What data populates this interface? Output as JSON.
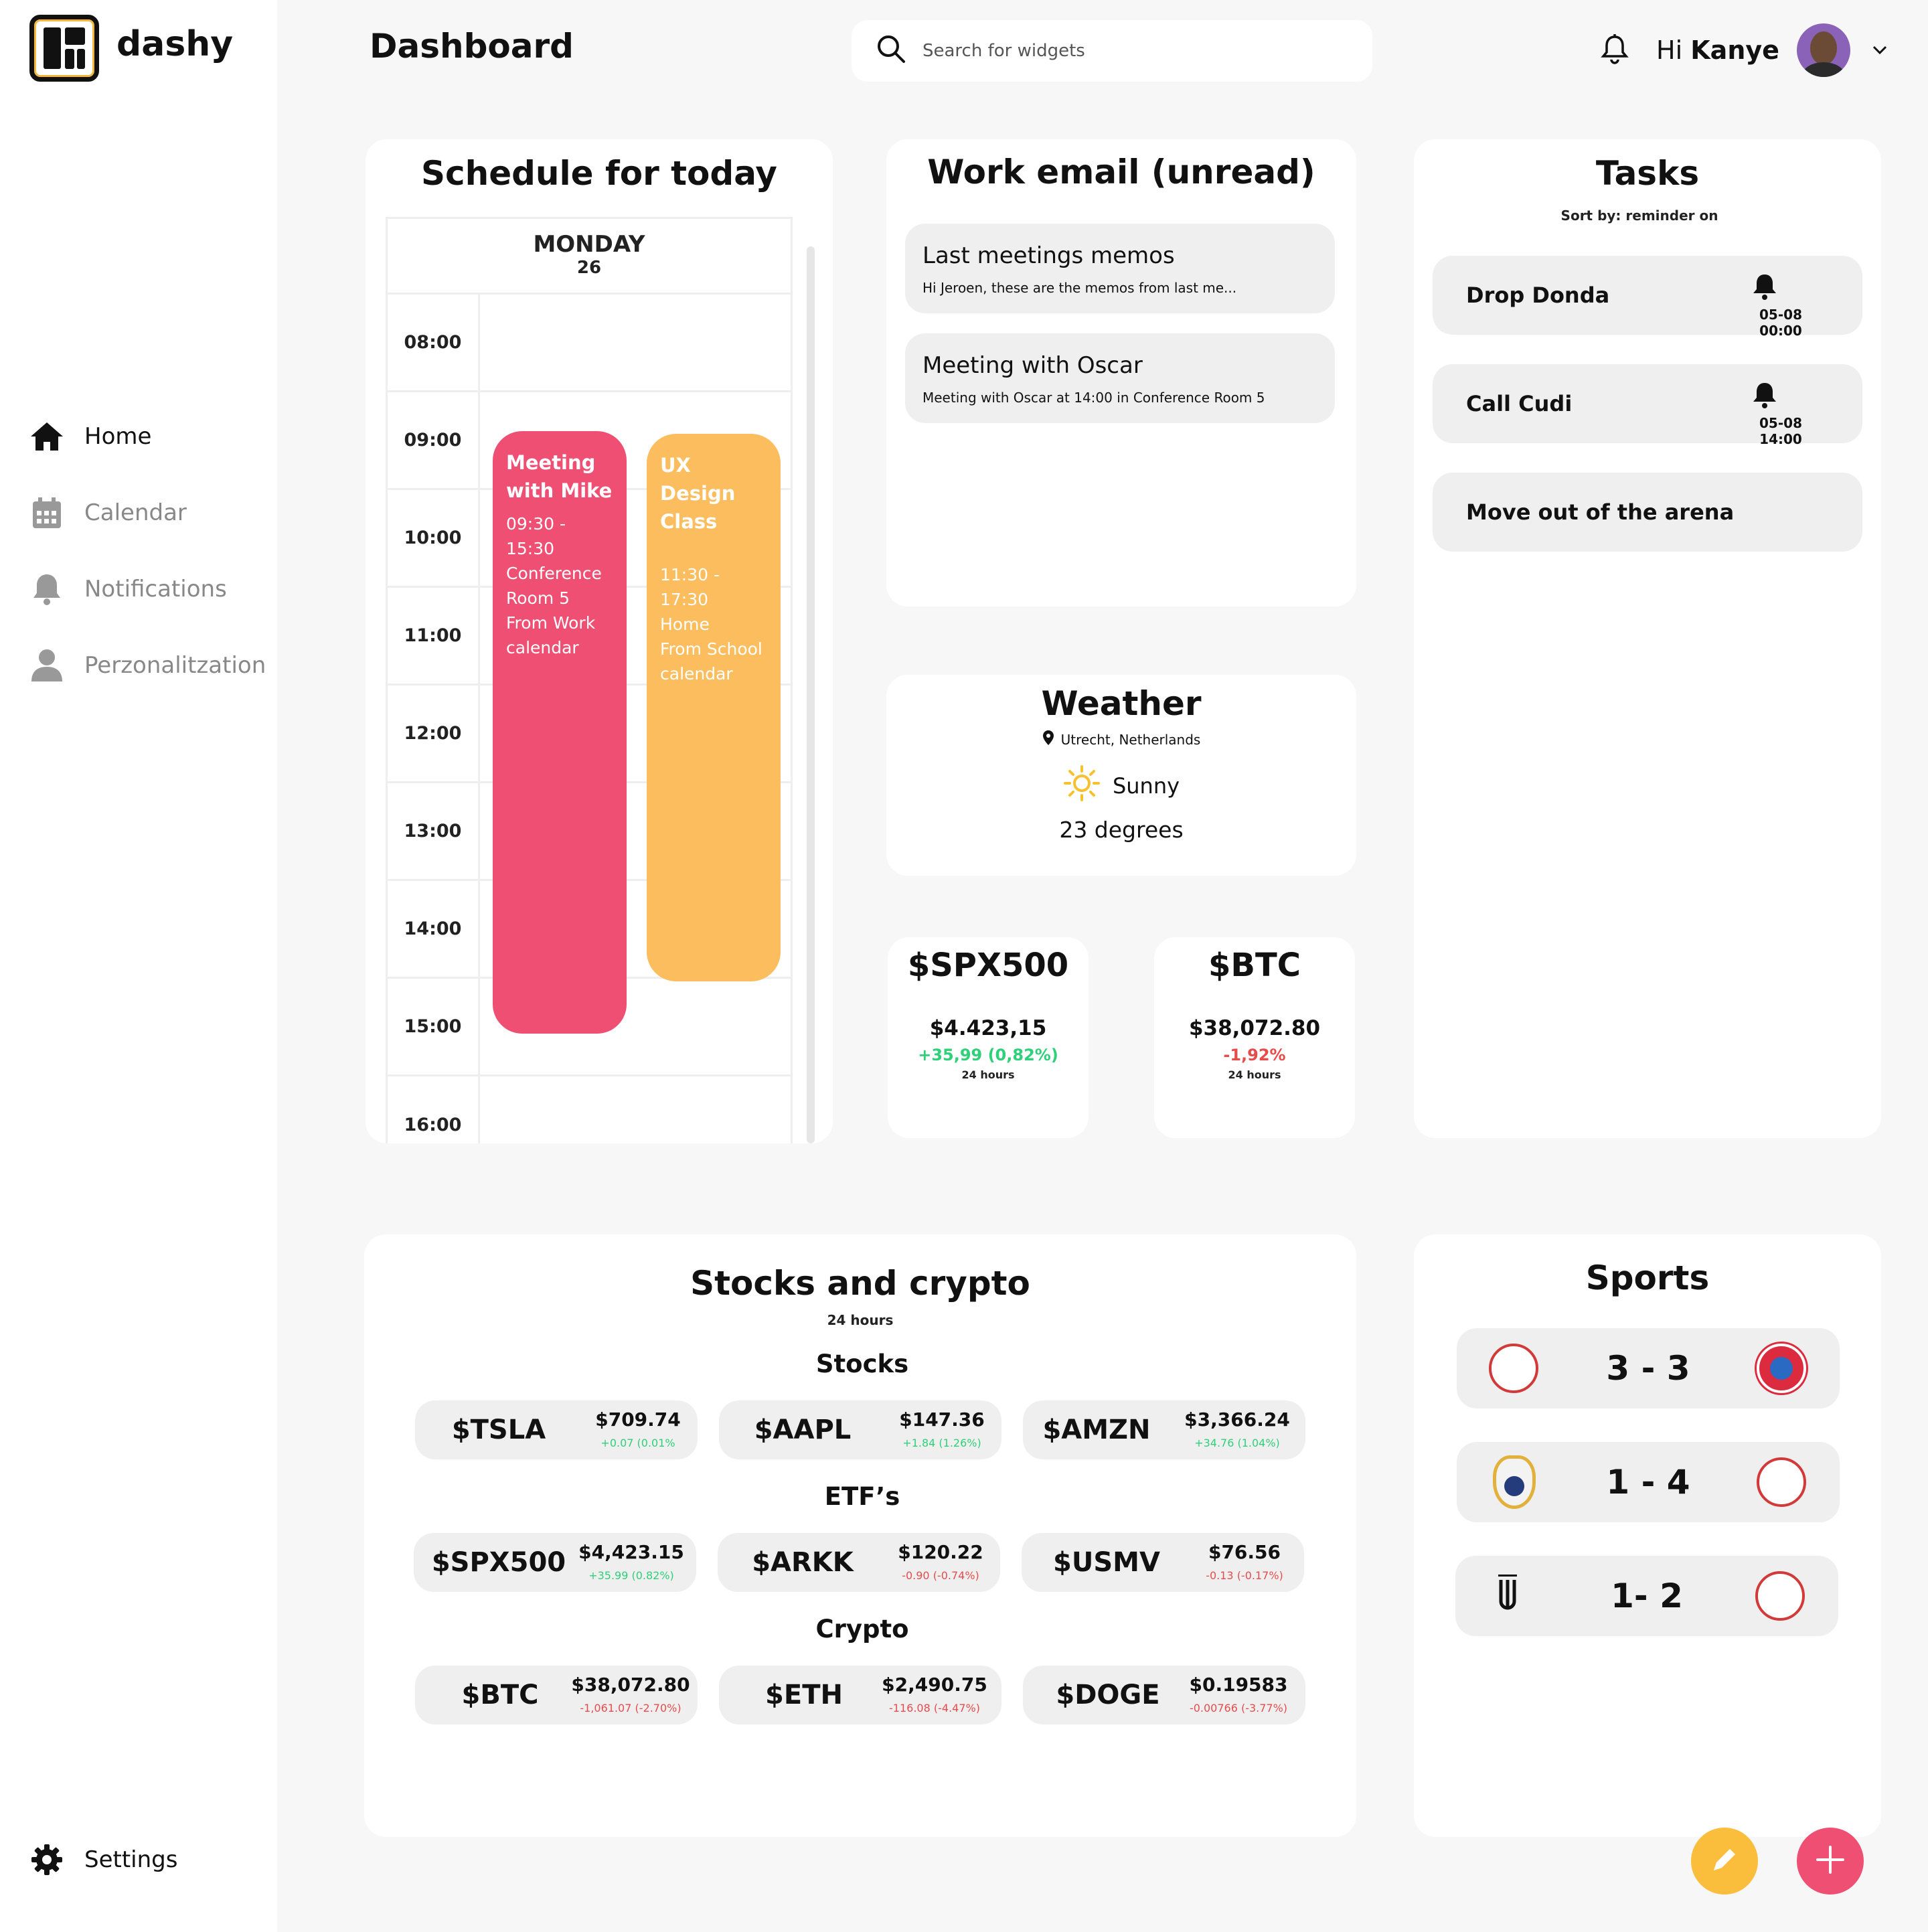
{
  "app": {
    "name": "dashy",
    "page_title": "Dashboard"
  },
  "search": {
    "placeholder": "Search for widgets"
  },
  "user": {
    "greeting": "Hi",
    "name": "Kanye"
  },
  "sidebar": {
    "items": [
      {
        "label": "Home",
        "icon": "home-icon",
        "active": true
      },
      {
        "label": "Calendar",
        "icon": "calendar-icon",
        "active": false
      },
      {
        "label": "Notifications",
        "icon": "bell-icon",
        "active": false
      },
      {
        "label": "Perzonalitzation",
        "icon": "user-icon",
        "active": false
      }
    ],
    "settings_label": "Settings"
  },
  "schedule": {
    "title": "Schedule for today",
    "day": "MONDAY",
    "date": "26",
    "times": [
      "08:00",
      "09:00",
      "10:00",
      "11:00",
      "12:00",
      "13:00",
      "14:00",
      "15:00",
      "16:00"
    ],
    "events": [
      {
        "title": "Meeting with Mike",
        "time": "09:30 - 15:30",
        "location": "Conference Room 5",
        "source": "From Work calendar",
        "color": "#ee4f72"
      },
      {
        "title": "UX Design Class",
        "time": "11:30 - 17:30",
        "location": "Home",
        "source": "From School calendar",
        "color": "#fbbd5e"
      }
    ]
  },
  "email": {
    "title": "Work email (unread)",
    "items": [
      {
        "subject": "Last meetings memos",
        "preview": "Hi Jeroen, these are the memos from last me..."
      },
      {
        "subject": "Meeting with Oscar",
        "preview": "Meeting with Oscar at 14:00 in Conference Room 5"
      }
    ]
  },
  "tasks": {
    "title": "Tasks",
    "sort_label": "Sort by: reminder on",
    "items": [
      {
        "label": "Drop Donda",
        "reminder": "05-08 00:00"
      },
      {
        "label": "Call Cudi",
        "reminder": "05-08 14:00"
      },
      {
        "label": "Move out of the arena",
        "reminder": ""
      }
    ]
  },
  "weather": {
    "title": "Weather",
    "location": "Utrecht, Netherlands",
    "condition": "Sunny",
    "temperature": "23 degrees"
  },
  "mini_tickers": [
    {
      "symbol": "$SPX500",
      "price": "$4.423,15",
      "change": "+35,99 (0,82%)",
      "direction": "up",
      "period": "24 hours"
    },
    {
      "symbol": "$BTC",
      "price": "$38,072.80",
      "change": "-1,92%",
      "direction": "down",
      "period": "24 hours"
    }
  ],
  "stocks": {
    "title": "Stocks and crypto",
    "period": "24 hours",
    "sections": [
      {
        "name": "Stocks",
        "items": [
          {
            "symbol": "$TSLA",
            "price": "$709.74",
            "change": "+0.07 (0.01%",
            "direction": "up"
          },
          {
            "symbol": "$AAPL",
            "price": "$147.36",
            "change": "+1.84 (1.26%)",
            "direction": "up"
          },
          {
            "symbol": "$AMZN",
            "price": "$3,366.24",
            "change": "+34.76 (1.04%)",
            "direction": "up"
          }
        ]
      },
      {
        "name": "ETF’s",
        "items": [
          {
            "symbol": "$SPX500",
            "price": "$4,423.15",
            "change": "+35.99 (0.82%)",
            "direction": "up"
          },
          {
            "symbol": "$ARKK",
            "price": "$120.22",
            "change": "-0.90 (-0.74%)",
            "direction": "down"
          },
          {
            "symbol": "$USMV",
            "price": "$76.56",
            "change": "-0.13 (-0.17%)",
            "direction": "down"
          }
        ]
      },
      {
        "name": "Crypto",
        "items": [
          {
            "symbol": "$BTC",
            "price": "$38,072.80",
            "change": "-1,061.07 (-2.70%)",
            "direction": "down"
          },
          {
            "symbol": "$ETH",
            "price": "$2,490.75",
            "change": "-116.08 (-4.47%)",
            "direction": "down"
          },
          {
            "symbol": "$DOGE",
            "price": "$0.19583",
            "change": "-0.00766 (-3.77%)",
            "direction": "down"
          }
        ]
      }
    ]
  },
  "sports": {
    "title": "Sports",
    "matches": [
      {
        "score": "3 - 3",
        "home_icon": "ajax-crest-icon",
        "away_icon": "bayern-crest-icon"
      },
      {
        "score": "1 - 4",
        "home_icon": "real-madrid-crest-icon",
        "away_icon": "ajax-crest-icon"
      },
      {
        "score": "1- 2",
        "home_icon": "juventus-crest-icon",
        "away_icon": "ajax-crest-icon"
      }
    ]
  },
  "colors": {
    "accent_pink": "#ee4f72",
    "accent_yellow": "#fbbd5e",
    "up": "#2fd07a",
    "down": "#e74c4c"
  }
}
